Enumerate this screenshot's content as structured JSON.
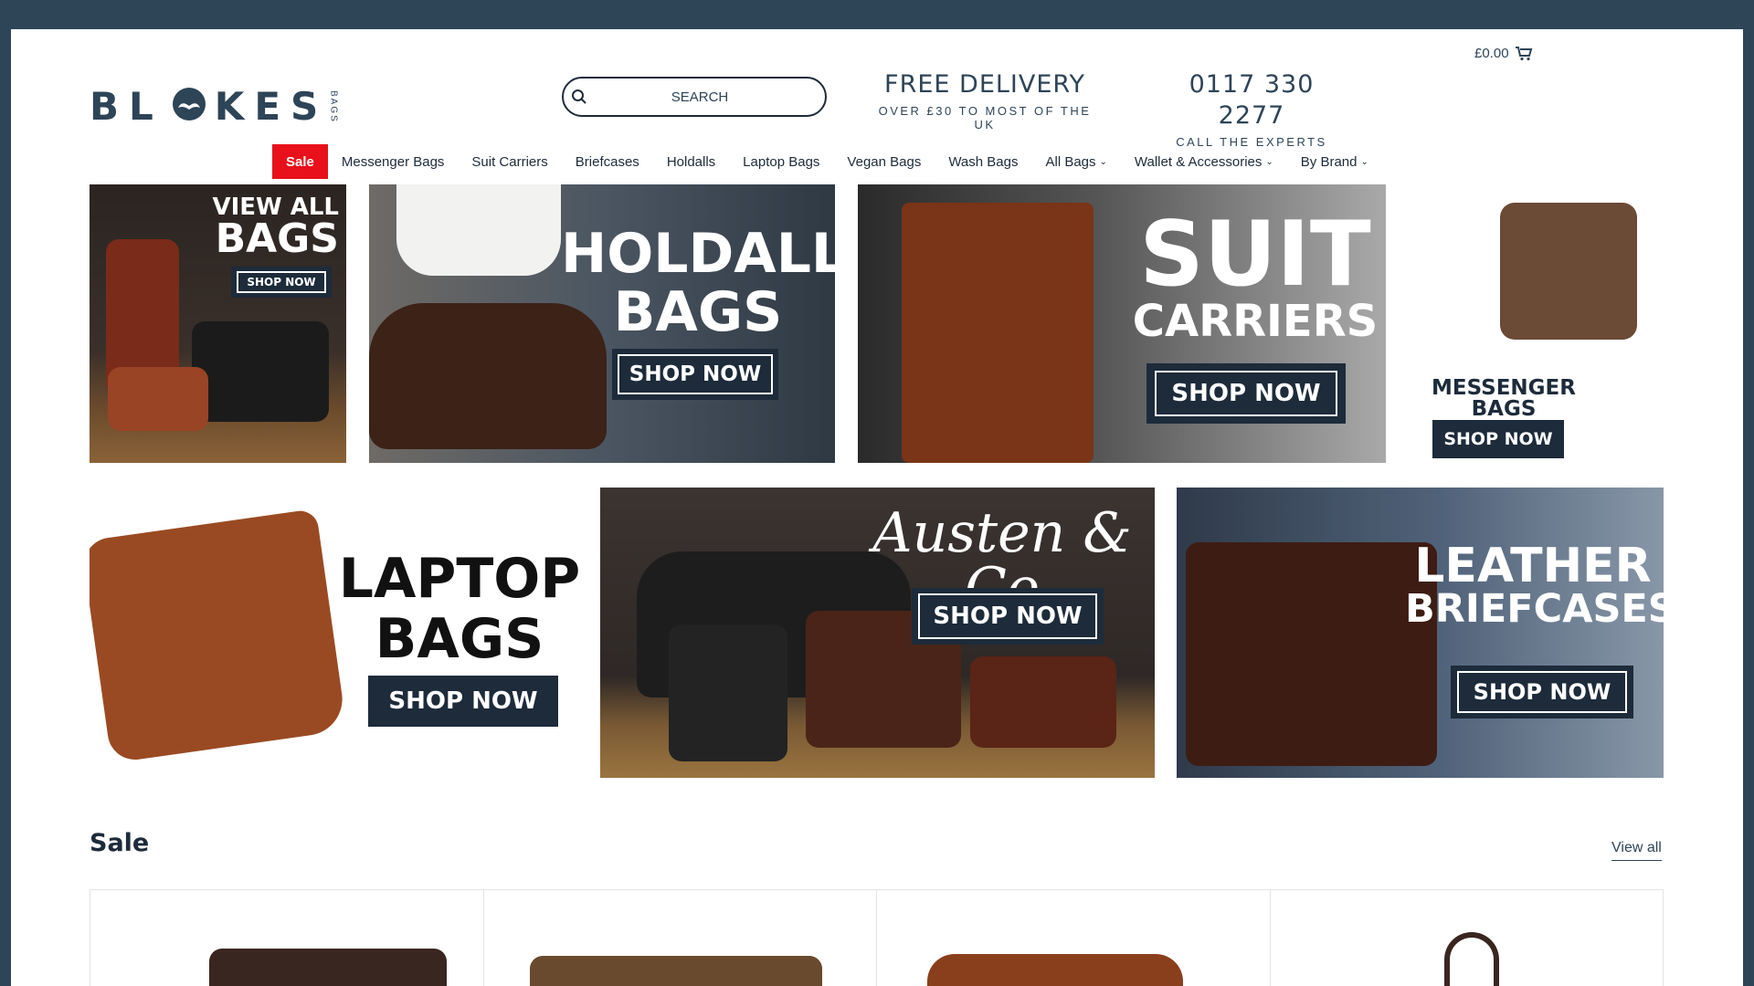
{
  "header": {
    "cart_total": "£0.00",
    "logo": {
      "word_left": "BL",
      "word_right": "KES",
      "sub": "BAGS"
    },
    "search": {
      "placeholder": "SEARCH"
    },
    "delivery": {
      "title": "FREE DELIVERY",
      "subtitle": "OVER £30 TO MOST OF THE UK"
    },
    "phone": {
      "number": "0117 330 2277",
      "subtitle": "CALL THE EXPERTS"
    }
  },
  "nav": {
    "items": [
      {
        "label": "Sale"
      },
      {
        "label": "Messenger Bags"
      },
      {
        "label": "Suit Carriers"
      },
      {
        "label": "Briefcases"
      },
      {
        "label": "Holdalls"
      },
      {
        "label": "Laptop Bags"
      },
      {
        "label": "Vegan Bags"
      },
      {
        "label": "Wash Bags"
      },
      {
        "label": "All Bags"
      },
      {
        "label": "Wallet & Accessories"
      },
      {
        "label": "By Brand"
      }
    ]
  },
  "banners": {
    "view_all": {
      "line1": "VIEW ALL",
      "line2": "BAGS",
      "cta": "SHOP NOW"
    },
    "holdall": {
      "line1": "HOLDALL",
      "line2": "BAGS",
      "cta": "SHOP NOW"
    },
    "suit": {
      "line1": "SUIT",
      "line2": "CARRIERS",
      "cta": "SHOP NOW"
    },
    "messenger": {
      "line1": "MESSENGER",
      "line2": "BAGS",
      "cta": "SHOP NOW"
    },
    "laptop": {
      "line1": "LAPTOP",
      "line2": "BAGS",
      "cta": "SHOP NOW"
    },
    "austen": {
      "brand": "Austen & Co",
      "cta": "SHOP NOW"
    },
    "briefcases": {
      "line1": "LEATHER",
      "line2": "BRIEFCASES",
      "cta": "SHOP NOW"
    }
  },
  "sale": {
    "title": "Sale",
    "view_all": "View all"
  },
  "colors": {
    "brand_navy": "#2e4457",
    "sale_red": "#e8101b",
    "frame": "#2e4457"
  }
}
